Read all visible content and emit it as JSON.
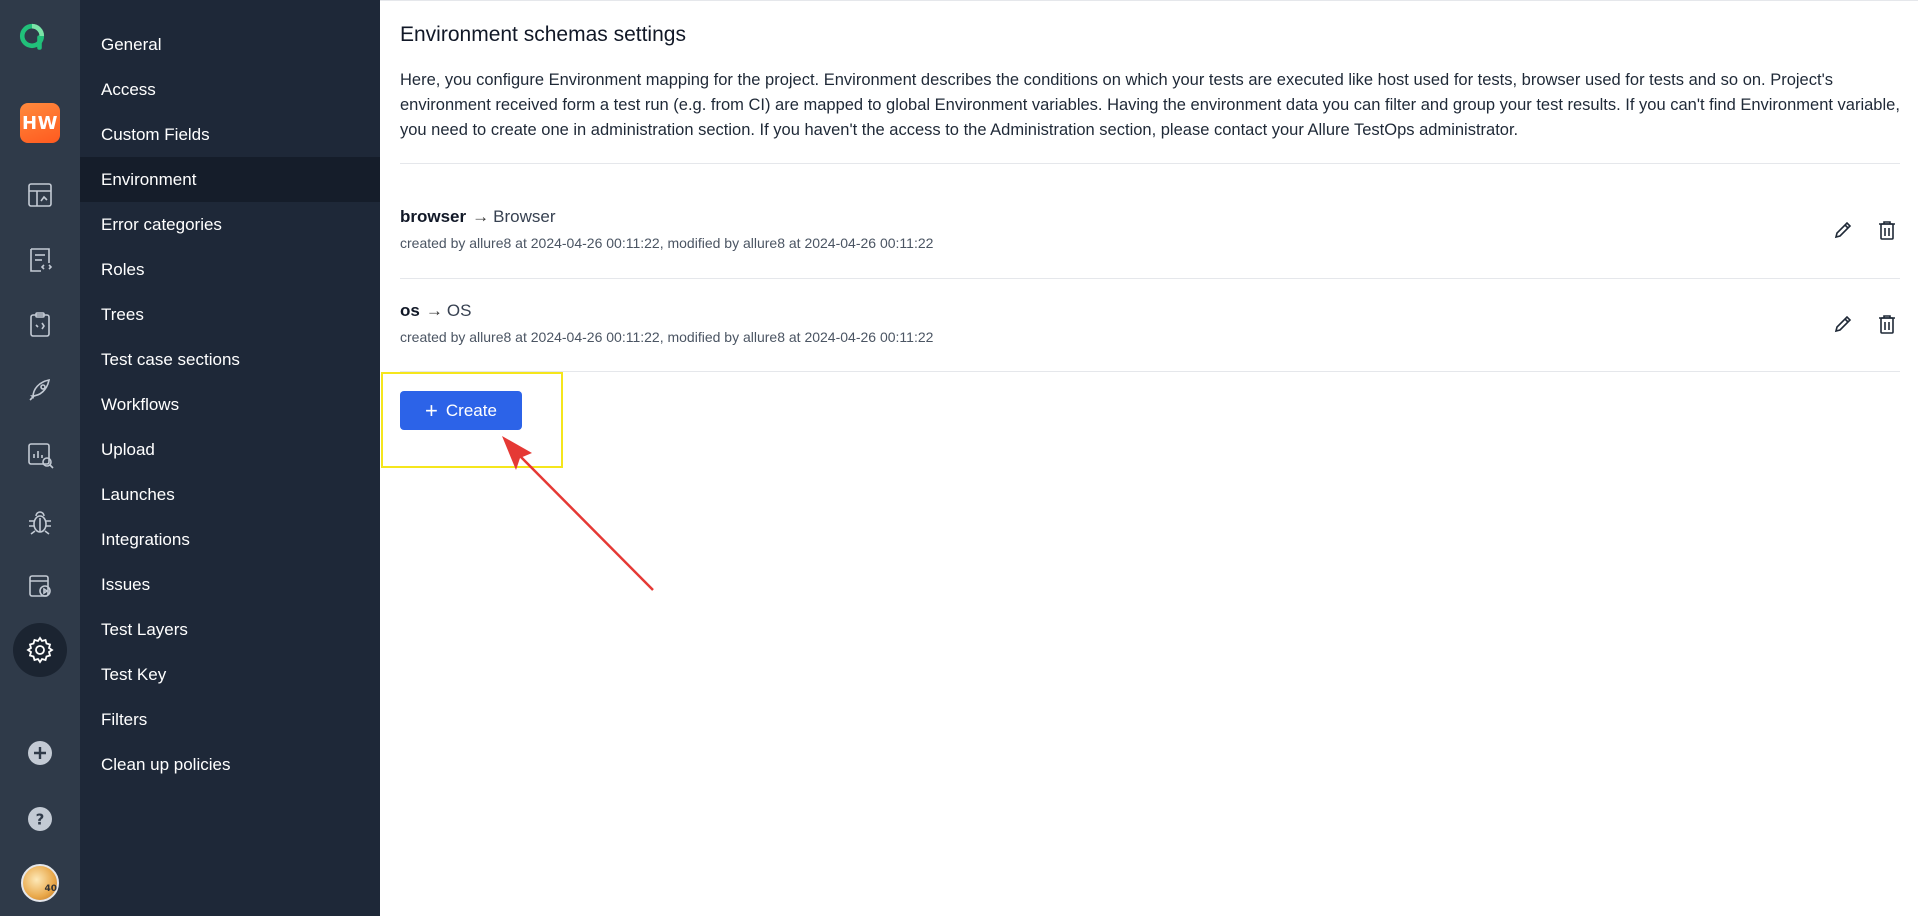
{
  "rail": {
    "logo_color": "#21c07a",
    "project_badge": "HW",
    "icons": [
      "dashboard-icon",
      "test-cases-icon",
      "test-plans-icon",
      "launches-icon",
      "analytics-icon",
      "defects-icon",
      "jobs-icon",
      "settings-icon",
      "add-icon",
      "help-icon"
    ],
    "avatar_badge": "40"
  },
  "menu": {
    "items": [
      {
        "label": "General"
      },
      {
        "label": "Access"
      },
      {
        "label": "Custom Fields"
      },
      {
        "label": "Environment"
      },
      {
        "label": "Error categories"
      },
      {
        "label": "Roles"
      },
      {
        "label": "Trees"
      },
      {
        "label": "Test case sections"
      },
      {
        "label": "Workflows"
      },
      {
        "label": "Upload"
      },
      {
        "label": "Launches"
      },
      {
        "label": "Integrations"
      },
      {
        "label": "Issues"
      },
      {
        "label": "Test Layers"
      },
      {
        "label": "Test Key"
      },
      {
        "label": "Filters"
      },
      {
        "label": "Clean up policies"
      }
    ],
    "active": "Environment"
  },
  "main": {
    "title": "Environment schemas settings",
    "description": "Here, you configure Environment mapping for the project. Environment describes the conditions on which your tests are executed like host used for tests, browser used for tests and so on. Project's environment received form a test run (e.g. from CI) are mapped to global Environment variables. Having the environment data you can filter and group your test results. If you can't find Environment variable, you need to create one in administration section. If you haven't the access to the Administration section, please contact your Allure TestOps administrator.",
    "schemas": [
      {
        "key": "browser",
        "arrow": "→",
        "value": "Browser",
        "meta": "created by allure8 at 2024-04-26 00:11:22, modified by allure8 at 2024-04-26 00:11:22"
      },
      {
        "key": "os",
        "arrow": "→",
        "value": "OS",
        "meta": "created by allure8 at 2024-04-26 00:11:22, modified by allure8 at 2024-04-26 00:11:22"
      }
    ],
    "create_label": "Create",
    "create_plus": "+"
  },
  "colors": {
    "rail_bg": "#2f3a49",
    "menu_bg": "#1e2838",
    "menu_active_bg": "#151d2a",
    "primary": "#2c63e8",
    "highlight_box": "#f5e61c",
    "annotation_arrow": "#e53935"
  }
}
